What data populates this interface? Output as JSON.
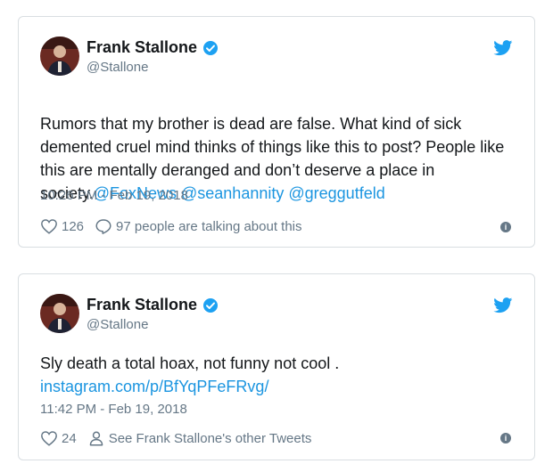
{
  "tweets": [
    {
      "author_name": "Frank Stallone",
      "handle": "@Stallone",
      "text_plain": "Rumors that my brother is dead are false. What kind of sick demented cruel mind thinks of things like this to post? People like this are mentally deranged and don’t deserve a place in society.",
      "mentions": [
        "@FoxNews",
        "@seanhannity",
        "@greggutfeld"
      ],
      "timestamp": "10:26 PM - Feb 19, 2018",
      "like_count": "126",
      "secondary_action": "97 people are talking about this",
      "secondary_icon": "speech-bubble-icon"
    },
    {
      "author_name": "Frank Stallone",
      "handle": "@Stallone",
      "text_plain": "Sly death a total hoax, not funny not cool .",
      "link": "instagram.com/p/BfYqPFeFRvg/",
      "timestamp": "11:42 PM - Feb 19, 2018",
      "like_count": "24",
      "secondary_action": "See Frank Stallone's other Tweets",
      "secondary_icon": "person-icon"
    }
  ],
  "colors": {
    "link": "#1b95e0",
    "text": "#14171a",
    "muted": "#657786",
    "verified": "#1da1f2"
  }
}
